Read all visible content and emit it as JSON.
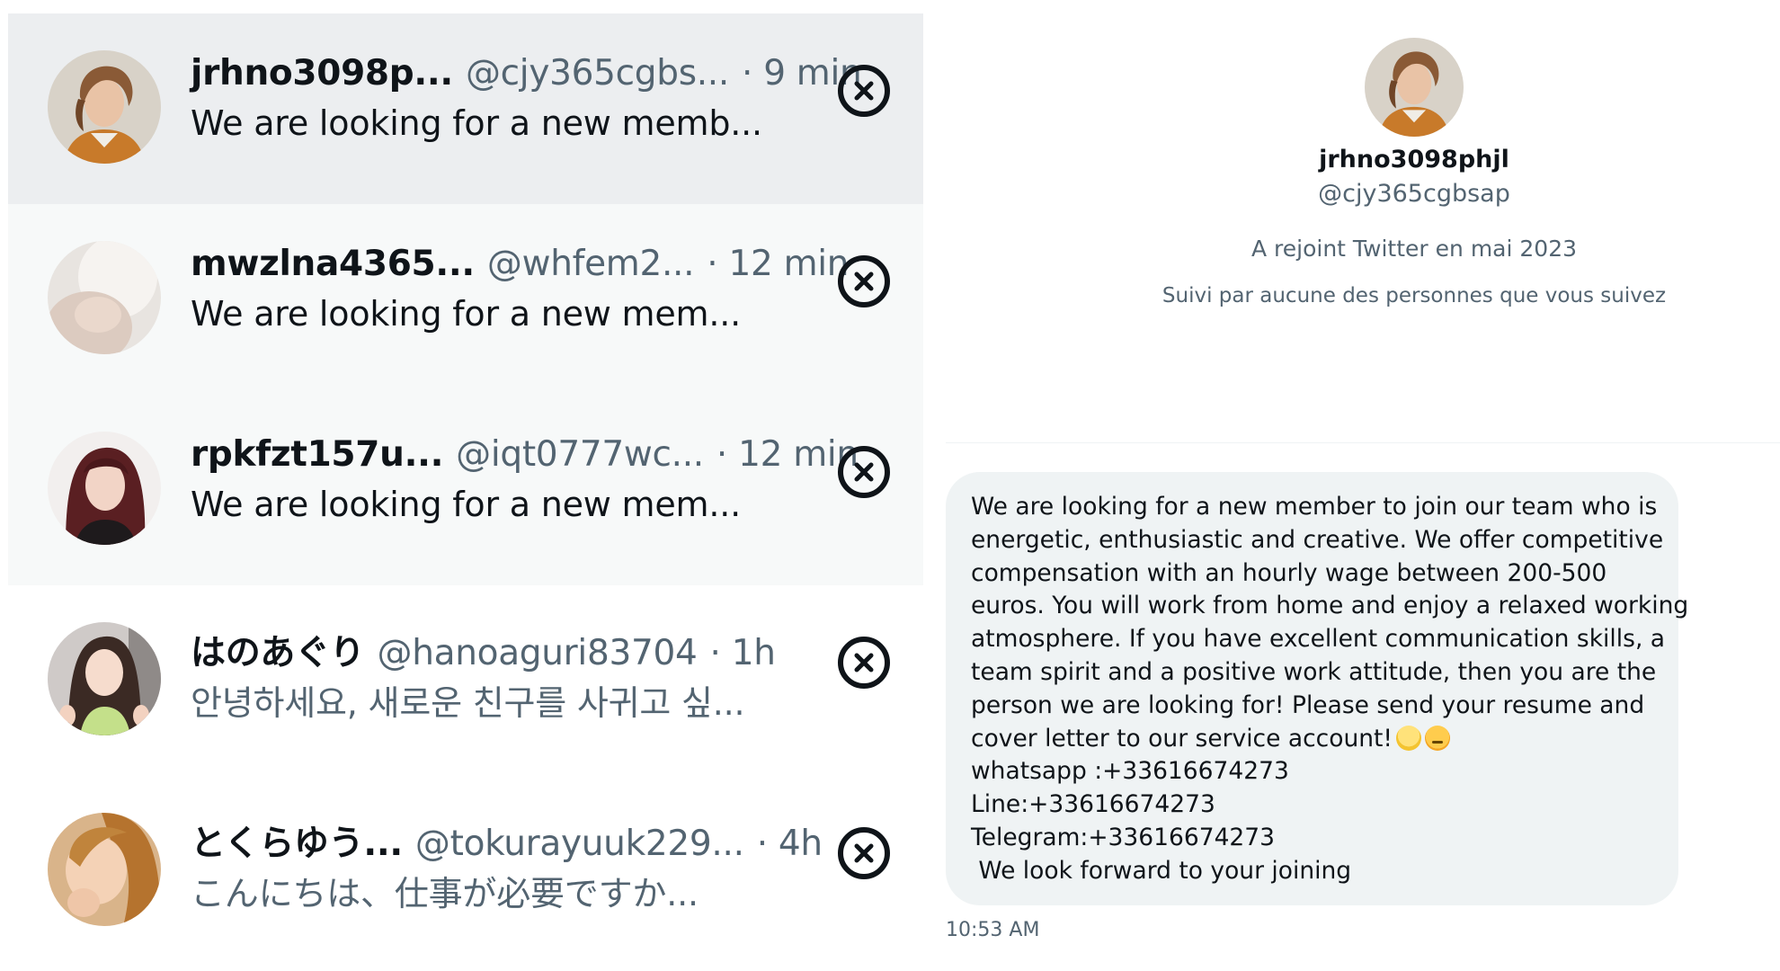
{
  "conversations": [
    {
      "name": "jrhno3098p...",
      "handle": "@cjy365cgbs...",
      "time": "· 9 min",
      "preview": "We are looking for a new memb...",
      "state": "selected"
    },
    {
      "name": "mwzlna4365...",
      "handle": "@whfem2...",
      "time": "· 12 min",
      "preview": "We are looking for a new mem...",
      "state": "unread"
    },
    {
      "name": "rpkfzt157u...",
      "handle": "@iqt0777wc...",
      "time": "· 12 min",
      "preview": "We are looking for a new mem...",
      "state": "unread"
    },
    {
      "name": "はのあぐり",
      "handle": "@hanoaguri83704",
      "time": "· 1h",
      "preview": "안녕하세요, 새로운 친구를 사귀고 싶...",
      "state": "read"
    },
    {
      "name": "とくらゆう...",
      "handle": "@tokurayuuk229...",
      "time": "· 4h",
      "preview": "こんにちは、仕事が必要ですか...",
      "state": "read"
    }
  ],
  "profile": {
    "name": "jrhno3098phjl",
    "handle": "@cjy365cgbsap",
    "joined": "A rejoint Twitter en mai 2023",
    "followers": "Suivi par aucune des personnes que vous suivez"
  },
  "message": {
    "lines": [
      "We are looking for a new member to join our team who is",
      "energetic, enthusiastic and creative. We offer competitive",
      "compensation with an hourly wage between 200-500",
      "euros. You will work from home and enjoy a relaxed working",
      "atmosphere. If you have excellent communication skills, a",
      "team spirit and a positive work attitude, then you are the",
      "person we are looking for! Please send your resume and",
      "cover letter to our service account!",
      "whatsapp :+33616674273",
      "Line:+33616674273",
      "Telegram:+33616674273",
      " We look forward to your joining"
    ],
    "time": "10:53 AM"
  },
  "icons": {
    "dismiss": "close-icon",
    "emoji_1": "hatching-chick-emoji",
    "emoji_2": "unamused-face-emoji"
  },
  "colors": {
    "selected_bg": "#eceef0",
    "unread_bg": "#f7f9f9",
    "secondary_text": "#536471",
    "bubble_bg": "#eff3f4"
  }
}
